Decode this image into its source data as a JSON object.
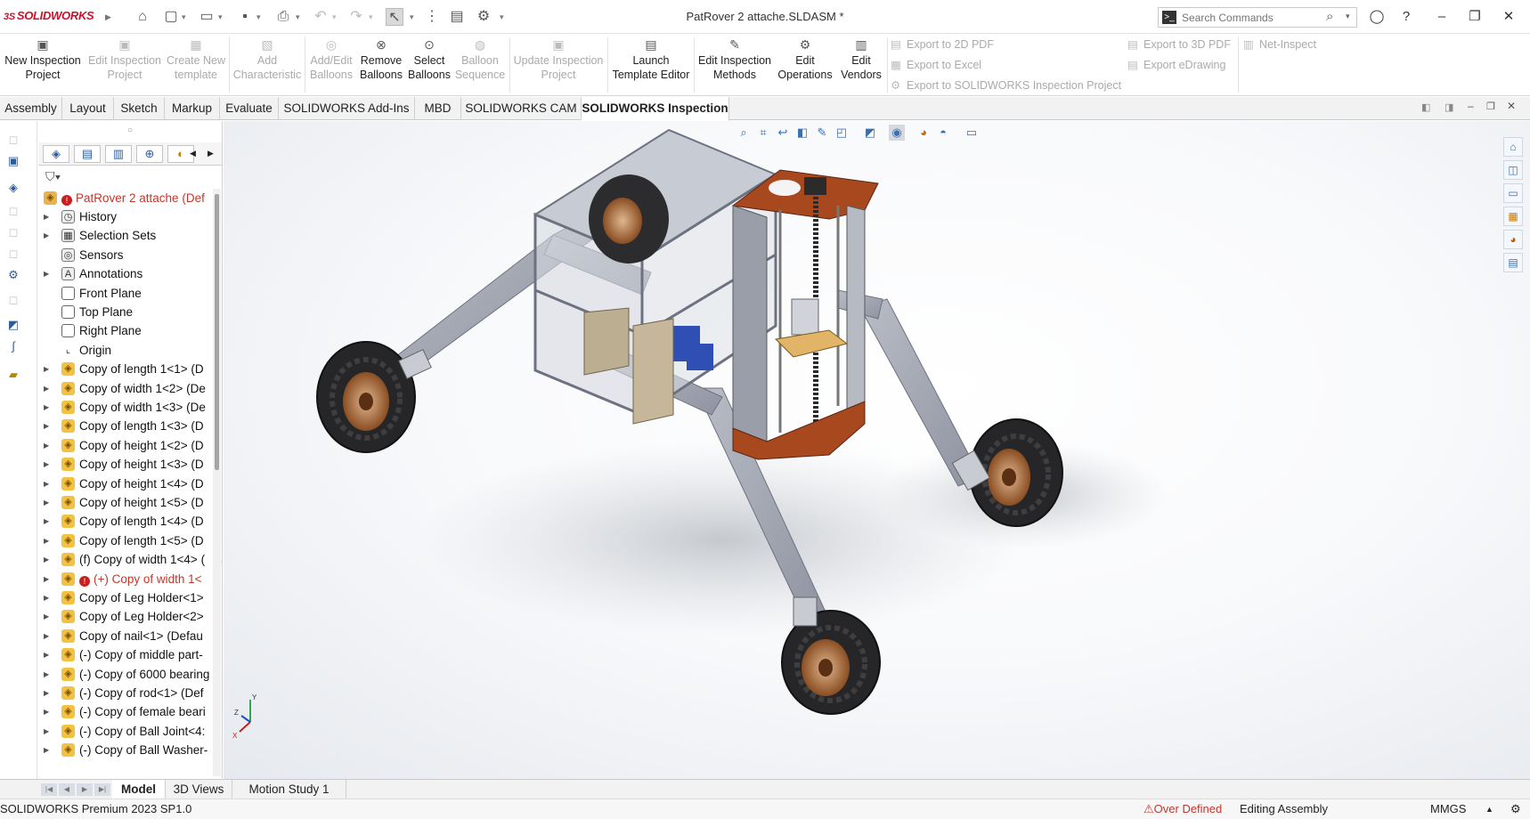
{
  "app": {
    "logo": "SOLIDWORKS",
    "document_title": "PatRover 2 attache.SLDASM *"
  },
  "search": {
    "placeholder": "Search Commands",
    "value": ""
  },
  "window_controls": [
    "help",
    "minimize",
    "restore",
    "close"
  ],
  "ribbon": {
    "buttons": [
      {
        "id": "new-inspection-project",
        "label1": "New Inspection",
        "label2": "Project",
        "enabled": true,
        "icon": "document-plus-icon"
      },
      {
        "id": "edit-inspection-project",
        "label1": "Edit Inspection",
        "label2": "Project",
        "enabled": false,
        "icon": "document-edit-icon"
      },
      {
        "id": "create-new-template",
        "label1": "Create New",
        "label2": "template",
        "enabled": false,
        "icon": "template-icon"
      },
      {
        "id": "add-characteristic",
        "label1": "Add",
        "label2": "Characteristic",
        "enabled": false,
        "icon": "characteristic-icon"
      },
      {
        "id": "add-edit-balloons",
        "label1": "Add/Edit",
        "label2": "Balloons",
        "enabled": false,
        "icon": "balloon-icon"
      },
      {
        "id": "remove-balloons",
        "label1": "Remove",
        "label2": "Balloons",
        "enabled": true,
        "icon": "balloon-remove-icon"
      },
      {
        "id": "select-balloons",
        "label1": "Select",
        "label2": "Balloons",
        "enabled": true,
        "icon": "balloon-select-icon"
      },
      {
        "id": "balloon-sequence",
        "label1": "Balloon",
        "label2": "Sequence",
        "enabled": false,
        "icon": "sequence-icon"
      },
      {
        "id": "update-inspection-project",
        "label1": "Update Inspection",
        "label2": "Project",
        "enabled": false,
        "icon": "update-icon"
      },
      {
        "id": "launch-template-editor",
        "label1": "Launch",
        "label2": "Template Editor",
        "enabled": true,
        "icon": "launch-icon"
      },
      {
        "id": "edit-inspection-methods",
        "label1": "Edit Inspection",
        "label2": "Methods",
        "enabled": true,
        "icon": "methods-icon"
      },
      {
        "id": "edit-operations",
        "label1": "Edit",
        "label2": "Operations",
        "enabled": true,
        "icon": "gear-icon"
      },
      {
        "id": "edit-vendors",
        "label1": "Edit",
        "label2": "Vendors",
        "enabled": true,
        "icon": "vendor-icon"
      }
    ],
    "small_buttons": [
      {
        "id": "export-2d-pdf",
        "label": "Export to 2D PDF"
      },
      {
        "id": "export-excel",
        "label": "Export to Excel"
      },
      {
        "id": "export-sw-inspection-project",
        "label": "Export to SOLIDWORKS Inspection Project"
      },
      {
        "id": "export-3d-pdf",
        "label": "Export to 3D PDF"
      },
      {
        "id": "export-edrawing",
        "label": "Export eDrawing"
      },
      {
        "id": "net-inspect",
        "label": "Net-Inspect"
      }
    ]
  },
  "tabs": [
    "Assembly",
    "Layout",
    "Sketch",
    "Markup",
    "Evaluate",
    "SOLIDWORKS Add-Ins",
    "MBD",
    "SOLIDWORKS CAM",
    "SOLIDWORKS Inspection"
  ],
  "active_tab": "SOLIDWORKS Inspection",
  "tree": {
    "root": "PatRover 2 attache (Def",
    "items": [
      {
        "label": "History",
        "icon": "history-icon",
        "expand": true
      },
      {
        "label": "Selection Sets",
        "icon": "selection-sets-icon",
        "expand": true
      },
      {
        "label": "Sensors",
        "icon": "sensor-icon",
        "expand": false
      },
      {
        "label": "Annotations",
        "icon": "annotations-icon",
        "expand": true
      },
      {
        "label": "Front Plane",
        "icon": "plane-icon",
        "expand": false
      },
      {
        "label": "Top Plane",
        "icon": "plane-icon",
        "expand": false
      },
      {
        "label": "Right Plane",
        "icon": "plane-icon",
        "expand": false
      },
      {
        "label": "Origin",
        "icon": "origin-icon",
        "expand": false
      },
      {
        "label": "Copy of length 1<1> (D",
        "icon": "component-icon",
        "expand": true
      },
      {
        "label": "Copy of width 1<2> (De",
        "icon": "component-icon",
        "expand": true
      },
      {
        "label": "Copy of width 1<3> (De",
        "icon": "component-icon",
        "expand": true
      },
      {
        "label": "Copy of length 1<3> (D",
        "icon": "component-icon",
        "expand": true
      },
      {
        "label": "Copy of height 1<2> (D",
        "icon": "component-icon",
        "expand": true
      },
      {
        "label": "Copy of height 1<3> (D",
        "icon": "component-icon",
        "expand": true
      },
      {
        "label": "Copy of height 1<4> (D",
        "icon": "component-icon",
        "expand": true
      },
      {
        "label": "Copy of height 1<5> (D",
        "icon": "component-icon",
        "expand": true
      },
      {
        "label": "Copy of length 1<4> (D",
        "icon": "component-icon",
        "expand": true
      },
      {
        "label": "Copy of length 1<5> (D",
        "icon": "component-icon",
        "expand": true
      },
      {
        "label": "(f) Copy of width 1<4> (",
        "icon": "component-icon",
        "expand": true
      },
      {
        "label": "(+) Copy of width 1<",
        "icon": "component-icon",
        "expand": true,
        "error": true
      },
      {
        "label": "Copy of Leg Holder<1>",
        "icon": "component-icon",
        "expand": true
      },
      {
        "label": "Copy of Leg Holder<2>",
        "icon": "component-icon",
        "expand": true
      },
      {
        "label": "Copy of nail<1> (Defau",
        "icon": "component-icon",
        "expand": true
      },
      {
        "label": "(-) Copy of middle part-",
        "icon": "component-icon",
        "expand": true
      },
      {
        "label": "(-) Copy of 6000 bearing",
        "icon": "component-icon",
        "expand": true
      },
      {
        "label": "(-) Copy of rod<1> (Def",
        "icon": "component-icon",
        "expand": true
      },
      {
        "label": "(-) Copy of female beari",
        "icon": "component-icon",
        "expand": true
      },
      {
        "label": "(-) Copy of Ball Joint<4:",
        "icon": "component-icon",
        "expand": true
      },
      {
        "label": "(-) Copy of Ball Washer-",
        "icon": "component-icon",
        "expand": true
      }
    ]
  },
  "triad": {
    "x": "X",
    "y": "Y",
    "z": "Z"
  },
  "bottom_tabs": [
    "Model",
    "3D Views",
    "Motion Study 1"
  ],
  "active_bottom_tab": "Model",
  "status": {
    "left": "SOLIDWORKS Premium 2023 SP1.0",
    "warning": "Over Defined",
    "mode": "Editing Assembly",
    "units": "MMGS"
  },
  "colors": {
    "accent": "#2a5d9f",
    "brand": "#d0102a",
    "error": "#c5362a"
  }
}
